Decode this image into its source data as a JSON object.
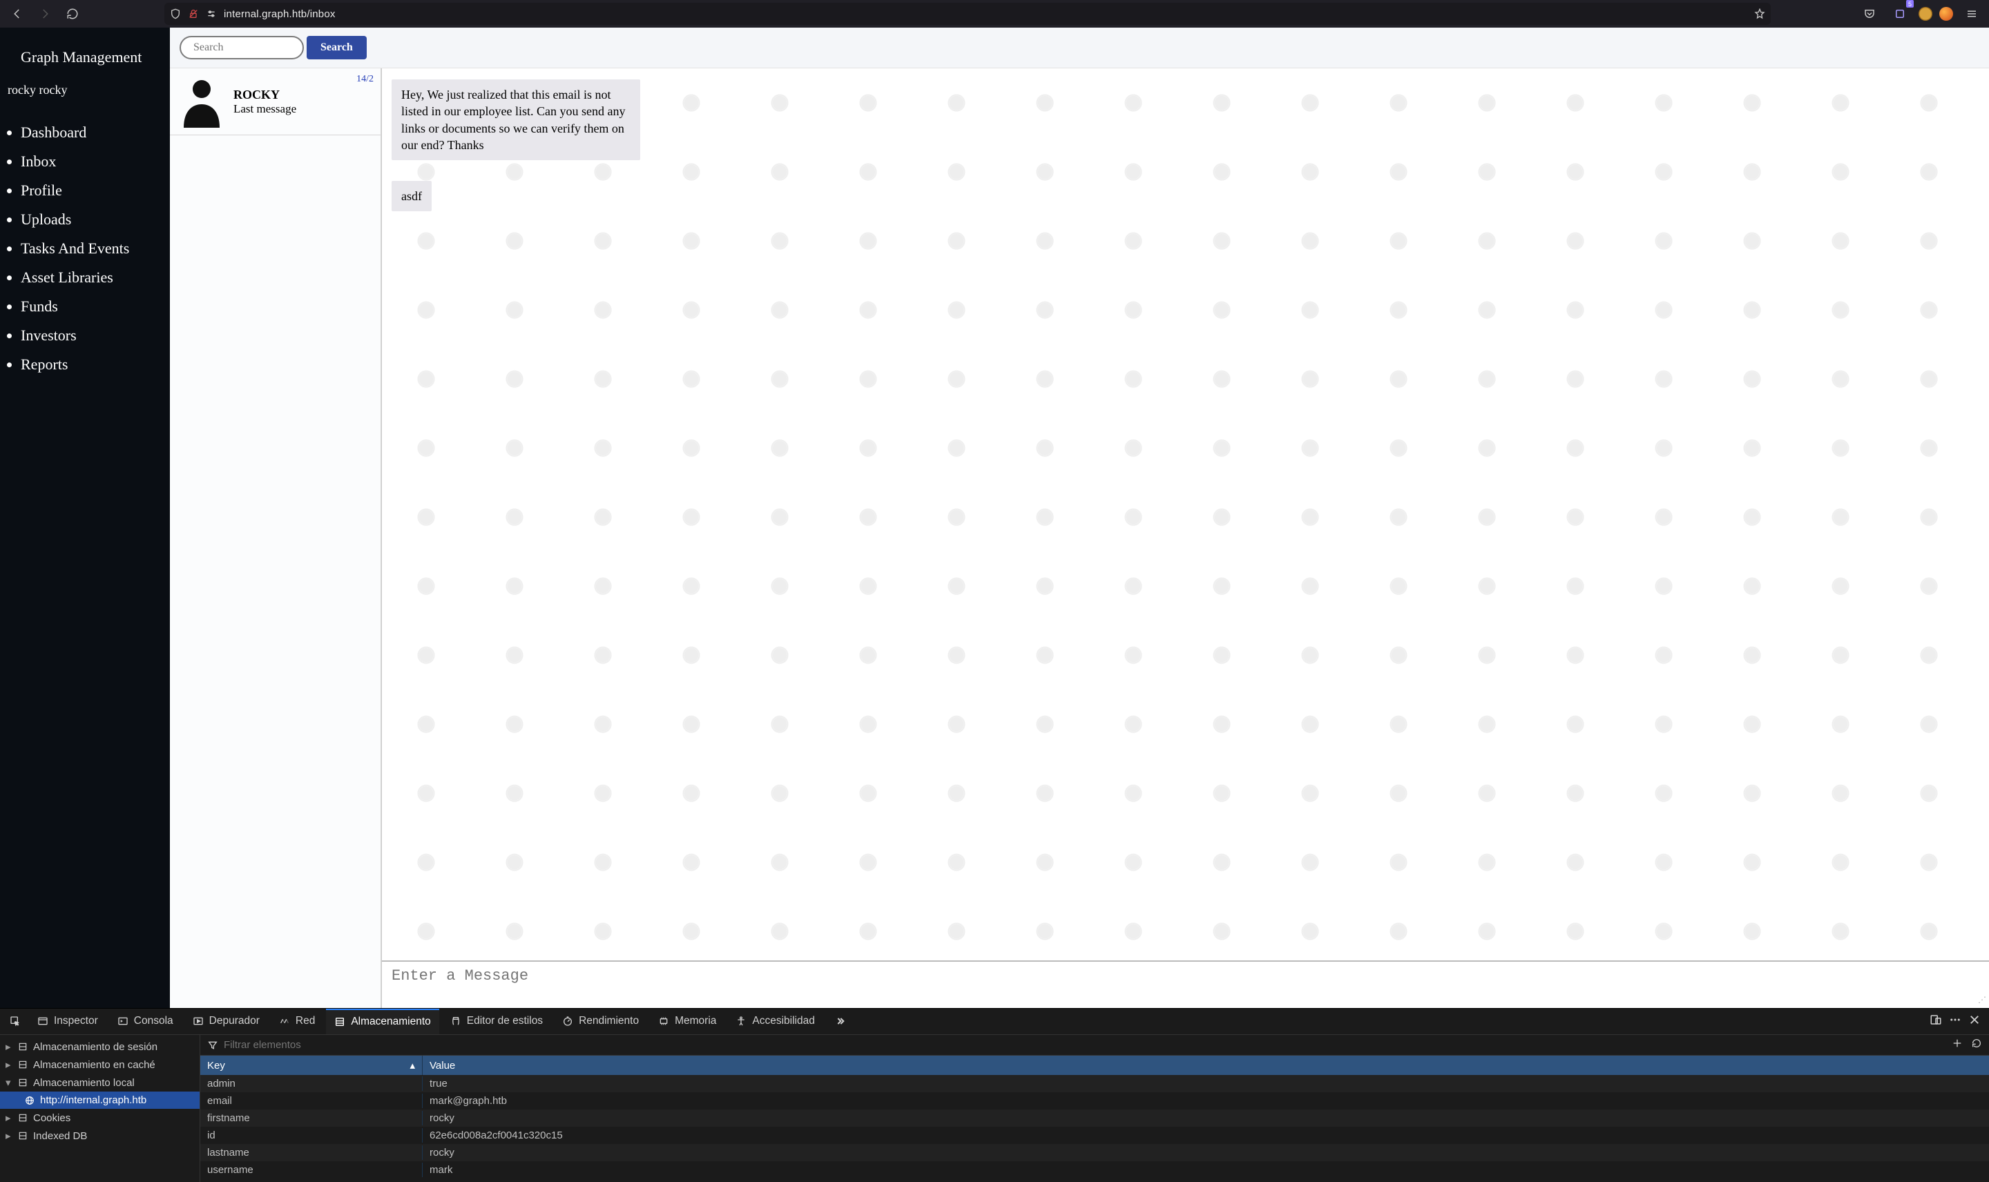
{
  "browser": {
    "url": "internal.graph.htb/inbox",
    "badge": "5"
  },
  "sidebar": {
    "brand": "Graph Management",
    "username": "rocky rocky",
    "items": [
      "Dashboard",
      "Inbox",
      "Profile",
      "Uploads",
      "Tasks And Events",
      "Asset Libraries",
      "Funds",
      "Investors",
      "Reports"
    ]
  },
  "search": {
    "placeholder": "Search",
    "button": "Search"
  },
  "conversation": {
    "name": "ROCKY",
    "sub": "Last message",
    "date": "14/2"
  },
  "messages": [
    "Hey, We just realized that this email is not listed in our employee list. Can you send any links or documents so we can verify them on our end? Thanks",
    "asdf"
  ],
  "composer": {
    "placeholder": "Enter a Message"
  },
  "devtools": {
    "tabs": [
      "Inspector",
      "Consola",
      "Depurador",
      "Red",
      "Almacenamiento",
      "Editor de estilos",
      "Rendimiento",
      "Memoria",
      "Accesibilidad"
    ],
    "active_tab": "Almacenamiento",
    "filter_placeholder": "Filtrar elementos",
    "tree": {
      "session": "Almacenamiento de sesión",
      "cache": "Almacenamiento en caché",
      "local": "Almacenamiento local",
      "origin": "http://internal.graph.htb",
      "cookies": "Cookies",
      "indexed": "Indexed DB"
    },
    "header": {
      "key": "Key",
      "value": "Value"
    },
    "rows": [
      {
        "k": "admin",
        "v": "true"
      },
      {
        "k": "email",
        "v": "mark@graph.htb"
      },
      {
        "k": "firstname",
        "v": "rocky"
      },
      {
        "k": "id",
        "v": "62e6cd008a2cf0041c320c15"
      },
      {
        "k": "lastname",
        "v": "rocky"
      },
      {
        "k": "username",
        "v": "mark"
      }
    ]
  }
}
